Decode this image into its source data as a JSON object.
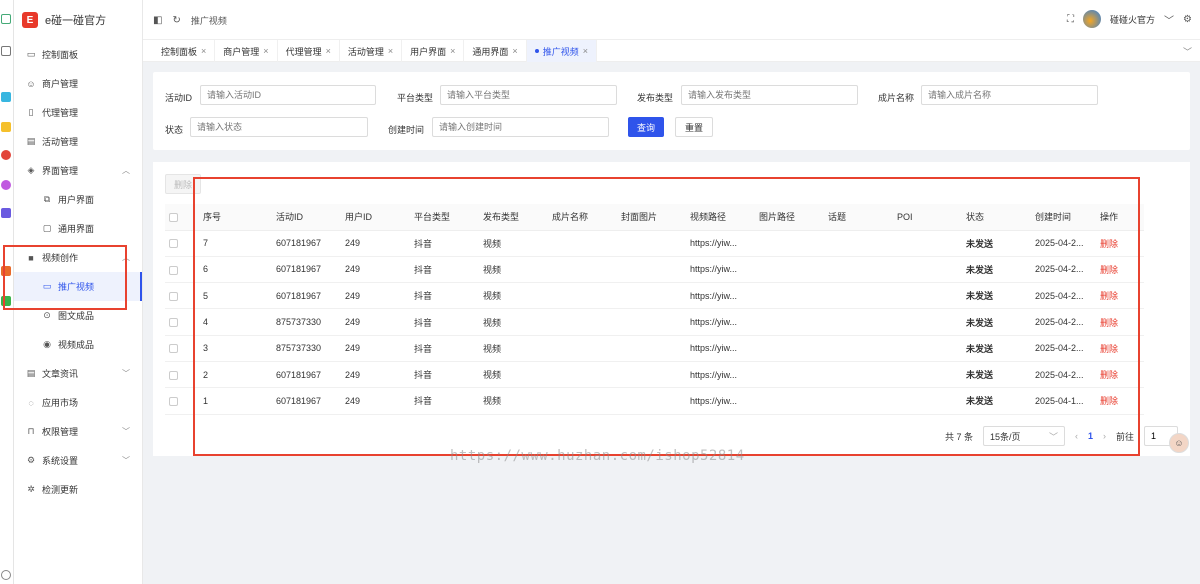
{
  "app": {
    "logo_mark": "E",
    "name": "e碰一碰官方"
  },
  "sidebar": {
    "items": [
      {
        "label": "控制面板",
        "icon": "monitor-icon",
        "glyph": "▭"
      },
      {
        "label": "商户管理",
        "icon": "user-icon",
        "glyph": "☺"
      },
      {
        "label": "代理管理",
        "icon": "file-icon",
        "glyph": "▯"
      },
      {
        "label": "活动管理",
        "icon": "calendar-icon",
        "glyph": "▤"
      },
      {
        "label": "界面管理",
        "icon": "layers-icon",
        "glyph": "◈",
        "chevron": "︿"
      },
      {
        "label": "用户界面",
        "icon": "copy-icon",
        "glyph": "⧉"
      },
      {
        "label": "通用界面",
        "icon": "box-icon",
        "glyph": "▢"
      },
      {
        "label": "视频创作",
        "icon": "video-icon",
        "glyph": "■",
        "chevron": "︿"
      },
      {
        "label": "推广视频",
        "icon": "camera-icon",
        "glyph": "▭"
      },
      {
        "label": "图文成品",
        "icon": "image-icon",
        "glyph": "⊙"
      },
      {
        "label": "视频成品",
        "icon": "play-icon",
        "glyph": "◉"
      },
      {
        "label": "文章资讯",
        "icon": "doc-icon",
        "glyph": "▤",
        "chevron": "﹀"
      },
      {
        "label": "应用市场",
        "icon": "app-icon",
        "glyph": "◌"
      },
      {
        "label": "权限管理",
        "icon": "lock-icon",
        "glyph": "⊓",
        "chevron": "﹀"
      },
      {
        "label": "系统设置",
        "icon": "settings-icon",
        "glyph": "⚙",
        "chevron": "﹀"
      },
      {
        "label": "检测更新",
        "icon": "update-icon",
        "glyph": "✲"
      }
    ]
  },
  "topbar": {
    "breadcrumb": "推广视频",
    "username": "碰碰火官方",
    "user_chevron": "﹀"
  },
  "tabs": [
    {
      "label": "控制面板"
    },
    {
      "label": "商户管理"
    },
    {
      "label": "代理管理"
    },
    {
      "label": "活动管理"
    },
    {
      "label": "用户界面"
    },
    {
      "label": "通用界面"
    },
    {
      "label": "推广视频"
    }
  ],
  "filters": {
    "activity_id": {
      "label": "活动ID",
      "placeholder": "请输入活动ID"
    },
    "platform": {
      "label": "平台类型",
      "placeholder": "请输入平台类型"
    },
    "publish_type": {
      "label": "发布类型",
      "placeholder": "请输入发布类型"
    },
    "film_name": {
      "label": "成片名称",
      "placeholder": "请输入成片名称"
    },
    "status": {
      "label": "状态",
      "placeholder": "请输入状态"
    },
    "created": {
      "label": "创建时间",
      "placeholder": "请输入创建时间"
    },
    "query_label": "查询",
    "reset_label": "重置"
  },
  "table": {
    "delete_label": "删除",
    "columns": [
      "序号",
      "活动ID",
      "用户ID",
      "平台类型",
      "发布类型",
      "成片名称",
      "封面图片",
      "视频路径",
      "图片路径",
      "话题",
      "POI",
      "状态",
      "创建时间",
      "操作"
    ],
    "rows": [
      [
        "7",
        "607181967",
        "249",
        "抖音",
        "视频",
        "",
        "",
        "https://yiw...",
        "",
        "",
        "",
        "未发送",
        "2025-04-2...",
        "删除"
      ],
      [
        "6",
        "607181967",
        "249",
        "抖音",
        "视频",
        "",
        "",
        "https://yiw...",
        "",
        "",
        "",
        "未发送",
        "2025-04-2...",
        "删除"
      ],
      [
        "5",
        "607181967",
        "249",
        "抖音",
        "视频",
        "",
        "",
        "https://yiw...",
        "",
        "",
        "",
        "未发送",
        "2025-04-2...",
        "删除"
      ],
      [
        "4",
        "875737330",
        "249",
        "抖音",
        "视频",
        "",
        "",
        "https://yiw...",
        "",
        "",
        "",
        "未发送",
        "2025-04-2...",
        "删除"
      ],
      [
        "3",
        "875737330",
        "249",
        "抖音",
        "视频",
        "",
        "",
        "https://yiw...",
        "",
        "",
        "",
        "未发送",
        "2025-04-2...",
        "删除"
      ],
      [
        "2",
        "607181967",
        "249",
        "抖音",
        "视频",
        "",
        "",
        "https://yiw...",
        "",
        "",
        "",
        "未发送",
        "2025-04-2...",
        "删除"
      ],
      [
        "1",
        "607181967",
        "249",
        "抖音",
        "视频",
        "",
        "",
        "https://yiw...",
        "",
        "",
        "",
        "未发送",
        "2025-04-1...",
        "删除"
      ]
    ]
  },
  "pagination": {
    "total": "共 7 条",
    "page_size": "15条/页",
    "current_page": "1",
    "jump_label": "前往",
    "jump_value": "1"
  },
  "watermark": "https://www.huzhan.com/ishop52814",
  "colors": {
    "primary": "#2f54eb",
    "danger": "#e8392a",
    "annotation": "#e8422f"
  }
}
